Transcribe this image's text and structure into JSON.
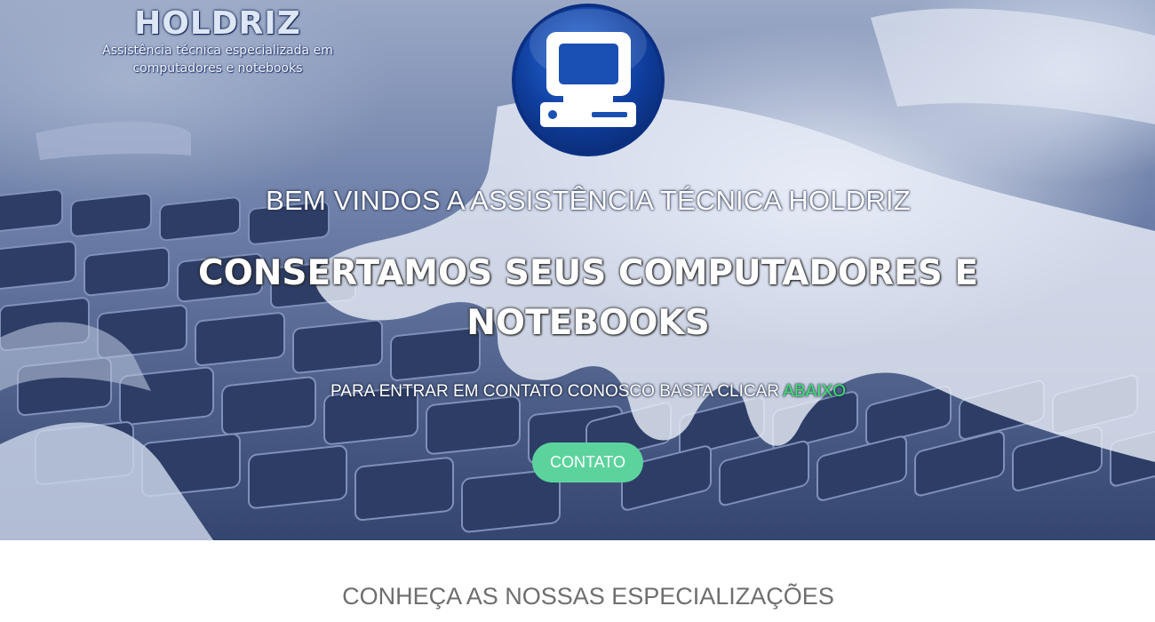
{
  "logo": {
    "name": "HOLDRIZ",
    "tagline_line1": "Assistência técnica especializada em",
    "tagline_line2": "computadores e notebooks"
  },
  "hero": {
    "welcome": "BEM VINDOS A ASSISTÊNCIA TÉCNICA HOLDRIZ",
    "headline_line1": "CONSERTAMOS SEUS COMPUTADORES E",
    "headline_line2": "NOTEBOOKS",
    "cta_text": "PARA ENTRAR EM CONTATO CONOSCO BASTA CLICAR",
    "cta_accent": "ABAIXO",
    "contact_button": "CONTATO"
  },
  "sections": {
    "specializations_title": "CONHEÇA AS NOSSAS ESPECIALIZAÇÕES"
  },
  "colors": {
    "accent_green": "#39e870",
    "button_green": "#5cd39d",
    "badge_blue": "#0f3f9f"
  },
  "icons": {
    "badge": "computer-monitor-icon"
  }
}
